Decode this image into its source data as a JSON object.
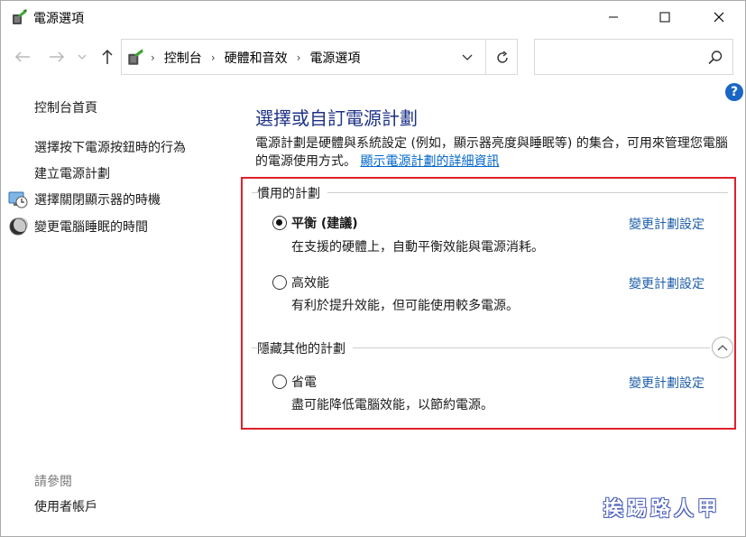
{
  "window": {
    "title": "電源選項"
  },
  "address": {
    "crumbs": [
      "控制台",
      "硬體和音效",
      "電源選項"
    ]
  },
  "search": {
    "placeholder": ""
  },
  "help": {
    "label": "?"
  },
  "sidebar": {
    "home": "控制台首頁",
    "items": [
      {
        "label": "選擇按下電源按鈕時的行為",
        "icon": ""
      },
      {
        "label": "建立電源計劃",
        "icon": ""
      },
      {
        "label": "選擇關閉顯示器的時機",
        "icon": "monitor-clock-icon"
      },
      {
        "label": "變更電腦睡眠的時間",
        "icon": "moon-sleep-icon"
      }
    ],
    "see_also": "請參閱",
    "user_accounts": "使用者帳戶"
  },
  "main": {
    "heading": "選擇或自訂電源計劃",
    "description": "電源計劃是硬體與系統設定 (例如，顯示器亮度與睡眠等) 的集合，可用來管理您電腦的電源使用方式。",
    "details_link": "顯示電源計劃的詳細資訊",
    "preferred_title": "慣用的計劃",
    "hidden_title": "隱藏其他的計劃",
    "plans": [
      {
        "name": "平衡 (建議)",
        "desc": "在支援的硬體上，自動平衡效能與電源消耗。",
        "link": "變更計劃設定",
        "selected": true
      },
      {
        "name": "高效能",
        "desc": "有利於提升效能，但可能使用較多電源。",
        "link": "變更計劃設定",
        "selected": false
      },
      {
        "name": "省電",
        "desc": "盡可能降低電腦效能，以節約電源。",
        "link": "變更計劃設定",
        "selected": false
      }
    ]
  },
  "watermark": "挨踢路人甲",
  "colors": {
    "accent": "#e0202a",
    "heading": "#1e3287",
    "link": "#1e5ea8"
  }
}
